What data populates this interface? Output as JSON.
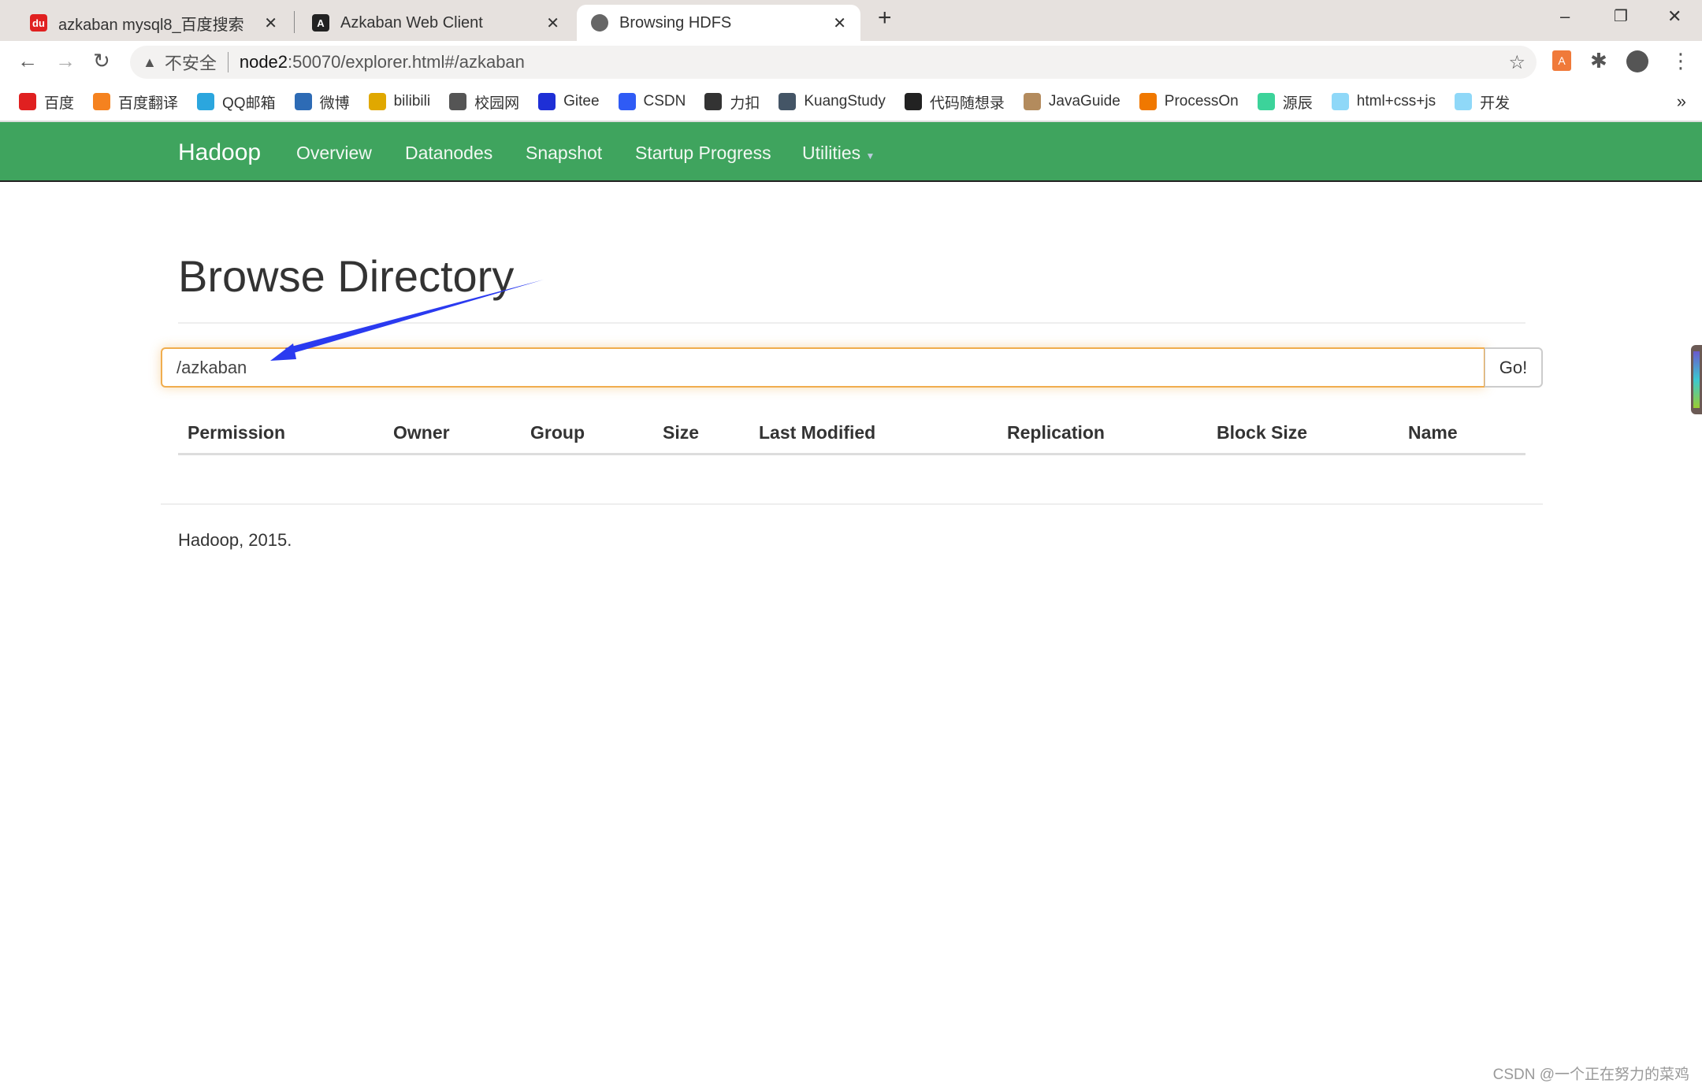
{
  "browser": {
    "tabs": [
      {
        "title": "azkaban mysql8_百度搜索",
        "icon": "baidu-icon",
        "active": false
      },
      {
        "title": "Azkaban Web Client",
        "icon": "azkaban-icon",
        "active": false
      },
      {
        "title": "Browsing HDFS",
        "icon": "globe-icon",
        "active": true
      }
    ],
    "security_label": "不安全",
    "url_host": "node2",
    "url_rest": ":50070/explorer.html#/azkaban",
    "bookmarks": [
      {
        "label": "百度",
        "color": "#e02020"
      },
      {
        "label": "百度翻译",
        "color": "#f5821f"
      },
      {
        "label": "QQ邮箱",
        "color": "#2ba6de"
      },
      {
        "label": "微博",
        "color": "#2d6bb5"
      },
      {
        "label": "bilibili",
        "color": "#e0a800"
      },
      {
        "label": "校园网",
        "color": "#555555"
      },
      {
        "label": "Gitee",
        "color": "#1e2fd6"
      },
      {
        "label": "CSDN",
        "color": "#2f5bf5"
      },
      {
        "label": "力扣",
        "color": "#333333"
      },
      {
        "label": "KuangStudy",
        "color": "#445566"
      },
      {
        "label": "代码随想录",
        "color": "#222222"
      },
      {
        "label": "JavaGuide",
        "color": "#b38b5d"
      },
      {
        "label": "ProcessOn",
        "color": "#f07800"
      },
      {
        "label": "源辰",
        "color": "#3cd39a"
      },
      {
        "label": "html+css+js",
        "color": "#8fd8f8"
      },
      {
        "label": "开发",
        "color": "#8fd8f8"
      }
    ],
    "more": "»"
  },
  "navbar": {
    "brand": "Hadoop",
    "items": [
      "Overview",
      "Datanodes",
      "Snapshot",
      "Startup Progress",
      "Utilities"
    ],
    "color": "#3fa45e"
  },
  "main": {
    "title": "Browse Directory",
    "path_value": "/azkaban",
    "go_label": "Go!",
    "columns": [
      "Permission",
      "Owner",
      "Group",
      "Size",
      "Last Modified",
      "Replication",
      "Block Size",
      "Name"
    ],
    "rows": []
  },
  "footer": "Hadoop, 2015.",
  "watermark": "CSDN @一个正在努力的菜鸡",
  "annotation_color": "#2a3af0"
}
